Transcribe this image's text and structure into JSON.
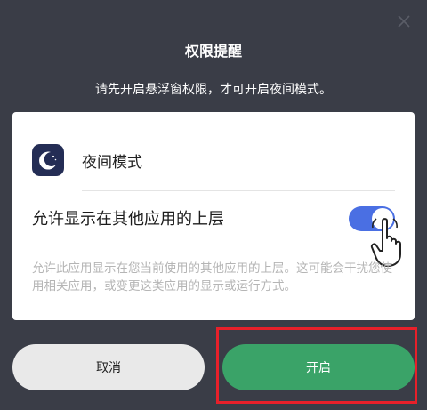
{
  "dialog": {
    "title": "权限提醒",
    "subtitle": "请先开启悬浮窗权限，才可开启夜间模式。",
    "close_icon": "close-icon"
  },
  "card": {
    "app_icon": "moon-icon",
    "app_name": "夜间模式",
    "permission_label": "允许显示在其他应用的上层",
    "toggle_on": true,
    "description": "允许此应用显示在您当前使用的其他应用的上层。这可能会干扰您使用相关应用，或变更这类应用的显示或运行方式。"
  },
  "buttons": {
    "cancel_label": "取消",
    "ok_label": "开启"
  },
  "colors": {
    "background": "#3a3d47",
    "toggle": "#4a6fe3",
    "ok_button": "#3aa368",
    "highlight": "#e8202a"
  }
}
